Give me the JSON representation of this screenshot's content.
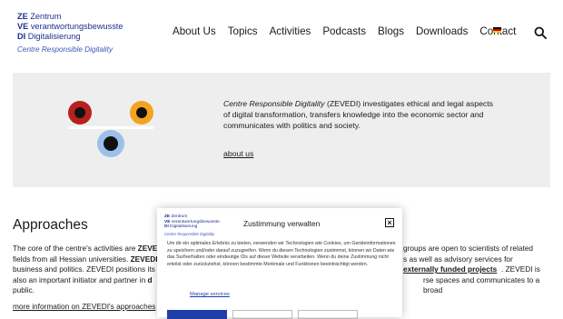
{
  "logo": {
    "line1_abbr": "ZE",
    "line1_text": "Zentrum",
    "line2_abbr": "VE",
    "line2_text": "verantwortungsbewusste",
    "line3_abbr": "DI",
    "line3_text": "Digitalisierung",
    "tagline": "Centre Responsible Digitality"
  },
  "nav": {
    "items": [
      "About Us",
      "Topics",
      "Activities",
      "Podcasts",
      "Blogs",
      "Downloads",
      "Contact"
    ]
  },
  "colors": {
    "brand_blue": "#1f2f8f",
    "dot_red": "#b6211c",
    "dot_orange": "#f2a41f",
    "dot_blue": "#9cc0ea",
    "hero_bg": "#eeeeee"
  },
  "hero": {
    "name": "Centre Responsible Digitality",
    "abbr": "(ZEVEDI)",
    "description": "investigates ethical and legal aspects of digital transformation, transfers knowledge into the economic sector and communicates with politics and society.",
    "link": "about us"
  },
  "approaches": {
    "heading": "Approaches",
    "p1a": "The core of the centre's activities are ",
    "p1b": "ZEVE",
    "p1c": "groups are open to scientists of related",
    "p2a": "fields from all Hessian universities. ",
    "p2b": "ZEVEDI",
    "p2c": "s as well as advisory services for",
    "p3a": "business and politics. ZEVEDI positions its",
    "p3b": "externally funded projects",
    "p3c": ". ZEVEDI is",
    "p4a": "also an important initiator and partner in ",
    "p4b": "d",
    "p4c": "rse spaces and communicates to a broad",
    "p5": "public.",
    "more_link": "more information on ZEVEDI's approaches"
  },
  "consent": {
    "title": "Zustimmung verwalten",
    "text": "Um dir ein optimales Erlebnis zu bieten, verwenden wir Technologien wie Cookies, um Geräteinformationen zu speichern und/oder darauf zuzugreifen. Wenn du diesen Technologien zustimmst, können wir Daten wie das Surfverhalten oder eindeutige IDs auf dieser Website verarbeiten. Wenn du deine Zustimmung nicht erteilst oder zurückziehst, können bestimmte Merkmale und Funktionen beeinträchtigt werden.",
    "manage": "Manage services"
  }
}
